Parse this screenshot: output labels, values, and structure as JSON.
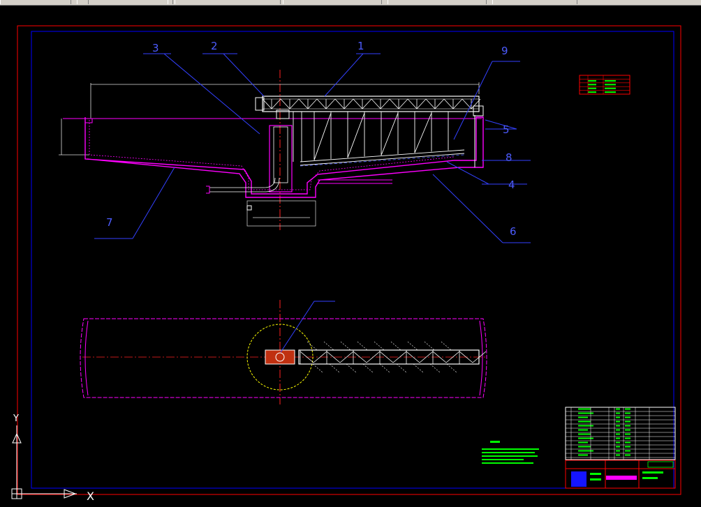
{
  "drawing": {
    "callouts": [
      "1",
      "2",
      "3",
      "4",
      "5",
      "6",
      "7",
      "8",
      "9"
    ],
    "ucs": {
      "y_label": "Y",
      "x_label": "X"
    },
    "colors": {
      "background": "#000000",
      "frame_outer": "#ff0000",
      "frame_inner": "#0000ff",
      "leader": "#3341ff",
      "centerline": "#ff2020",
      "tank": "#ff00ff",
      "truss": "#ffffff",
      "note": "#00ff00",
      "circle": "#ffff00",
      "dim": "#00ffff"
    }
  }
}
